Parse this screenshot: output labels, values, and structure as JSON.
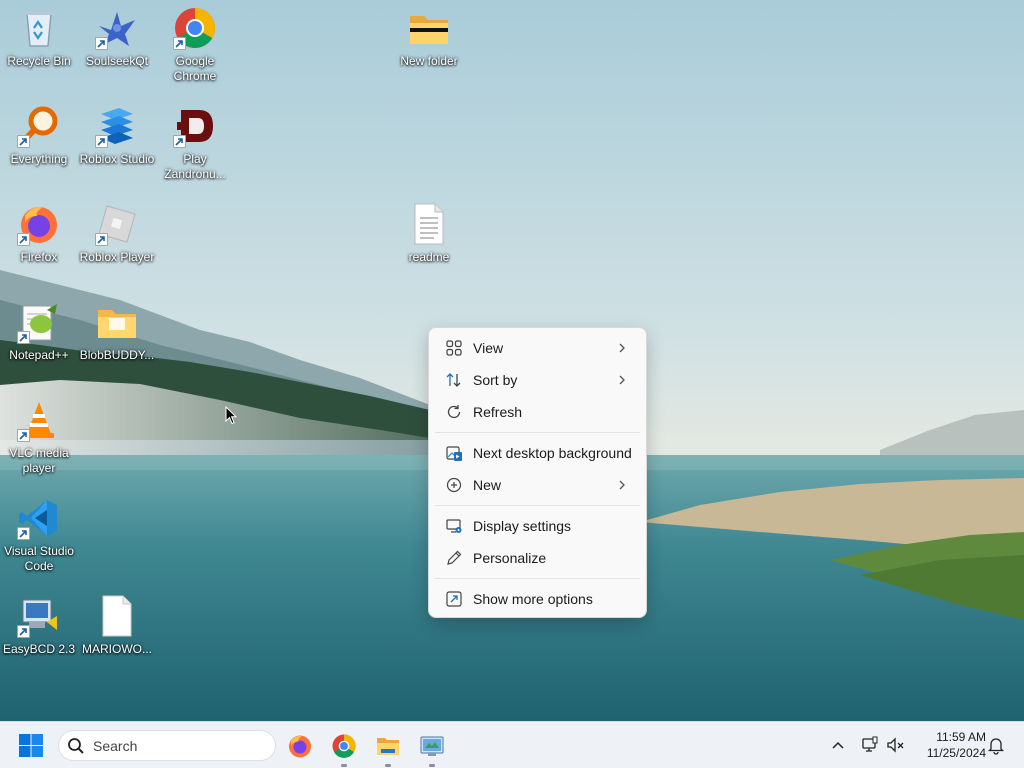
{
  "desktop_icons": [
    {
      "label": "Recycle Bin",
      "icon": "recycle-bin-icon",
      "shortcut": false
    },
    {
      "label": "SoulseekQt",
      "icon": "soulseek-bird-icon",
      "shortcut": true
    },
    {
      "label": "Google Chrome",
      "icon": "chrome-icon",
      "shortcut": true
    },
    {
      "label": "New folder",
      "icon": "folder-icon",
      "shortcut": false
    },
    {
      "label": "Everything",
      "icon": "everything-search-icon",
      "shortcut": true
    },
    {
      "label": "Roblox Studio",
      "icon": "roblox-studio-icon",
      "shortcut": true
    },
    {
      "label": "Play Zandronu...",
      "icon": "zandronum-icon",
      "shortcut": true
    },
    {
      "label": "Firefox",
      "icon": "firefox-icon",
      "shortcut": true
    },
    {
      "label": "Roblox Player",
      "icon": "roblox-player-icon",
      "shortcut": true
    },
    {
      "label": "readme",
      "icon": "text-file-icon",
      "shortcut": false
    },
    {
      "label": "Notepad++",
      "icon": "notepadpp-icon",
      "shortcut": true
    },
    {
      "label": "BlobBUDDY...",
      "icon": "folder-icon",
      "shortcut": false
    },
    {
      "label": "VLC media player",
      "icon": "vlc-icon",
      "shortcut": true
    },
    {
      "label": "Visual Studio Code",
      "icon": "vscode-icon",
      "shortcut": true
    },
    {
      "label": "EasyBCD 2.3",
      "icon": "easybcd-icon",
      "shortcut": true
    },
    {
      "label": "MARIOWO...",
      "icon": "blank-file-icon",
      "shortcut": false
    }
  ],
  "context_menu": {
    "items": [
      {
        "label": "View",
        "icon": "view-grid-icon",
        "submenu": true
      },
      {
        "label": "Sort by",
        "icon": "sort-icon",
        "submenu": true
      },
      {
        "label": "Refresh",
        "icon": "refresh-icon",
        "submenu": false
      },
      {
        "label": "Next desktop background",
        "icon": "next-background-icon",
        "submenu": false
      },
      {
        "label": "New",
        "icon": "new-plus-icon",
        "submenu": true
      },
      {
        "label": "Display settings",
        "icon": "display-settings-icon",
        "submenu": false
      },
      {
        "label": "Personalize",
        "icon": "pen-icon",
        "submenu": false
      },
      {
        "label": "Show more options",
        "icon": "show-more-options-icon",
        "submenu": false
      }
    ]
  },
  "taskbar": {
    "search_placeholder": "Search",
    "pinned_apps": [
      {
        "name": "Firefox",
        "icon": "firefox-icon",
        "running": false
      },
      {
        "name": "Google Chrome",
        "icon": "chrome-icon",
        "running": true
      },
      {
        "name": "File Explorer",
        "icon": "file-explorer-icon",
        "running": true
      },
      {
        "name": "Control Panel",
        "icon": "control-panel-icon",
        "running": true
      }
    ],
    "tray": {
      "time": "11:59 AM",
      "date": "11/25/2024"
    }
  },
  "colors": {
    "accent": "#0067c0",
    "menu_bg": "#f9f9f9",
    "taskbar_bg": "#eef1f5"
  }
}
